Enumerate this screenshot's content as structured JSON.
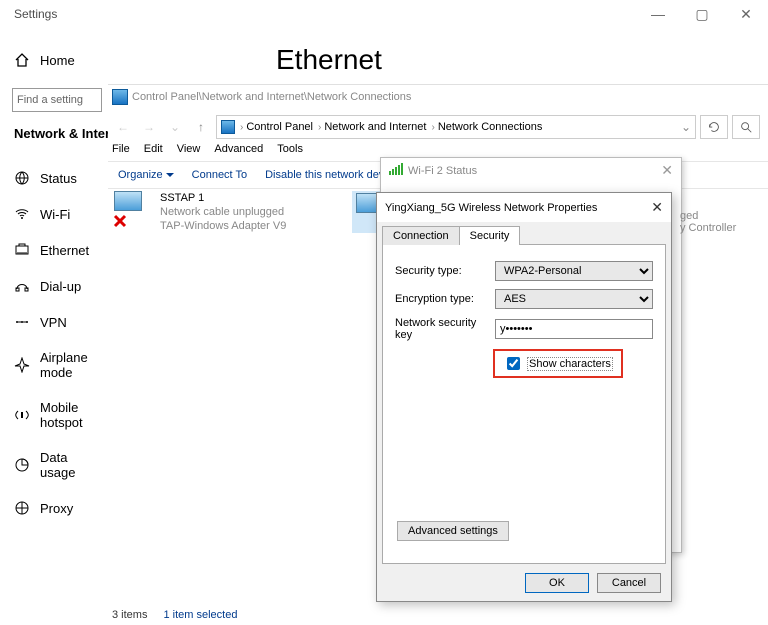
{
  "settings_header": "Settings",
  "window": {
    "min": "—",
    "max": "▢",
    "close": "✕"
  },
  "home": "Home",
  "find_placeholder": "Find a setting",
  "section": "Network & Internet",
  "sidebar": [
    {
      "label": "Status"
    },
    {
      "label": "Wi-Fi"
    },
    {
      "label": "Ethernet"
    },
    {
      "label": "Dial-up"
    },
    {
      "label": "VPN"
    },
    {
      "label": "Airplane mode"
    },
    {
      "label": "Mobile hotspot"
    },
    {
      "label": "Data usage"
    },
    {
      "label": "Proxy"
    }
  ],
  "page_title": "Ethernet",
  "explorer": {
    "cp_path": "Control Panel\\Network and Internet\\Network Connections",
    "crumbs": [
      "Control Panel",
      "Network and Internet",
      "Network Connections"
    ],
    "menus": [
      "File",
      "Edit",
      "View",
      "Advanced",
      "Tools"
    ],
    "toolbar": {
      "organize": "Organize",
      "connect": "Connect To",
      "disable": "Disable this network device"
    },
    "item1": {
      "name": "SSTAP 1",
      "sub1": "Network cable unplugged",
      "sub2": "TAP-Windows Adapter V9"
    }
  },
  "wifi_status_title": "Wi-Fi 2 Status",
  "back_labels": {
    "l1": "ged",
    "l2": "y Controller"
  },
  "props": {
    "title": "YingXiang_5G Wireless Network Properties",
    "tabs": {
      "connection": "Connection",
      "security": "Security"
    },
    "sec_type_label": "Security type:",
    "sec_type_value": "WPA2-Personal",
    "enc_label": "Encryption type:",
    "enc_value": "AES",
    "key_label": "Network security key",
    "key_value": "y•••••••",
    "show_chars": "Show characters",
    "advanced": "Advanced settings",
    "ok": "OK",
    "cancel": "Cancel"
  },
  "status": {
    "count": "3 items",
    "selected": "1 item selected"
  }
}
